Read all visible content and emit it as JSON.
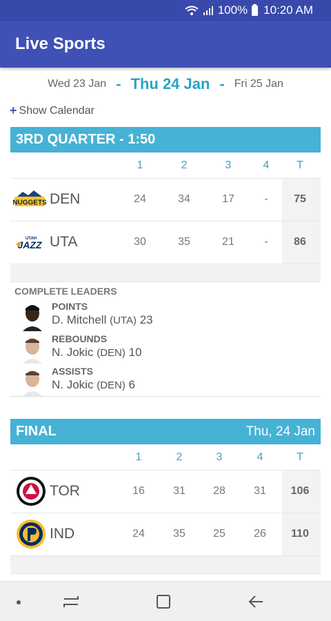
{
  "status_bar": {
    "battery": "100%",
    "time": "10:20 AM"
  },
  "app_bar": {
    "title": "Live Sports"
  },
  "date_nav": {
    "prev": "Wed 23 Jan",
    "current": "Thu 24 Jan",
    "next": "Fri 25 Jan",
    "dash": "-"
  },
  "show_calendar": {
    "plus": "+",
    "label": "Show Calendar"
  },
  "game1": {
    "status": "3RD QUARTER - 1:50",
    "date": "",
    "headers": [
      "1",
      "2",
      "3",
      "4",
      "T"
    ],
    "teams": [
      {
        "abbr": "DEN",
        "logo": "nuggets-logo-icon",
        "scores": [
          "24",
          "34",
          "17",
          "-",
          "75"
        ]
      },
      {
        "abbr": "UTA",
        "logo": "jazz-logo-icon",
        "scores": [
          "30",
          "35",
          "21",
          "-",
          "86"
        ]
      }
    ]
  },
  "leaders": {
    "title": "COMPLETE LEADERS",
    "items": [
      {
        "category": "POINTS",
        "player": "D. Mitchell",
        "team": "(UTA)",
        "value": "23"
      },
      {
        "category": "REBOUNDS",
        "player": "N. Jokic",
        "team": "(DEN)",
        "value": "10"
      },
      {
        "category": "ASSISTS",
        "player": "N. Jokic",
        "team": "(DEN)",
        "value": "6"
      }
    ]
  },
  "game2": {
    "status": "FINAL",
    "date": "Thu, 24 Jan",
    "headers": [
      "1",
      "2",
      "3",
      "4",
      "T"
    ],
    "teams": [
      {
        "abbr": "TOR",
        "logo": "raptors-logo-icon",
        "scores": [
          "16",
          "31",
          "28",
          "31",
          "106"
        ]
      },
      {
        "abbr": "IND",
        "logo": "pacers-logo-icon",
        "scores": [
          "24",
          "35",
          "25",
          "26",
          "110"
        ]
      }
    ]
  },
  "colors": {
    "app_bar": "#3f51b5",
    "status_bar": "#3949ab",
    "card_header": "#45b2d6",
    "accent_date": "#29a3c4"
  },
  "icons": [
    "wifi-icon",
    "signal-icon",
    "battery-icon",
    "recent-apps-icon",
    "home-icon",
    "back-icon"
  ]
}
